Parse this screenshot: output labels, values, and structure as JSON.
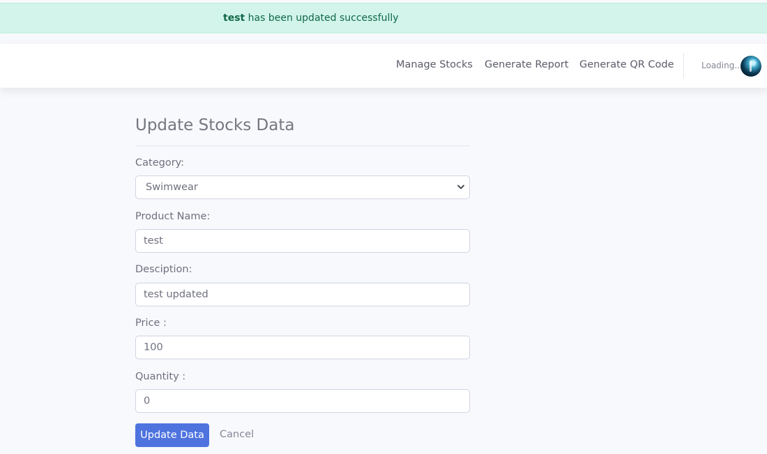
{
  "alert": {
    "bold": "test",
    "message": " has been updated successfully"
  },
  "topbar": {
    "nav": [
      "Manage Stocks",
      "Generate Report",
      "Generate QR Code"
    ],
    "user_name": "Loading..."
  },
  "form": {
    "title": "Update Stocks Data",
    "fields": [
      {
        "label": "Category:",
        "value": "Swimwear"
      },
      {
        "label": "Product Name:",
        "value": "test"
      },
      {
        "label": "Desciption:",
        "value": "test updated"
      },
      {
        "label": "Price :",
        "value": "100"
      },
      {
        "label": "Quantity :",
        "value": "0"
      }
    ],
    "submit_label": "Update Data",
    "cancel_label": "Cancel"
  },
  "colors": {
    "primary": "#4e73df",
    "alert_bg": "#d2f4ea",
    "alert_text": "#0f6848"
  }
}
